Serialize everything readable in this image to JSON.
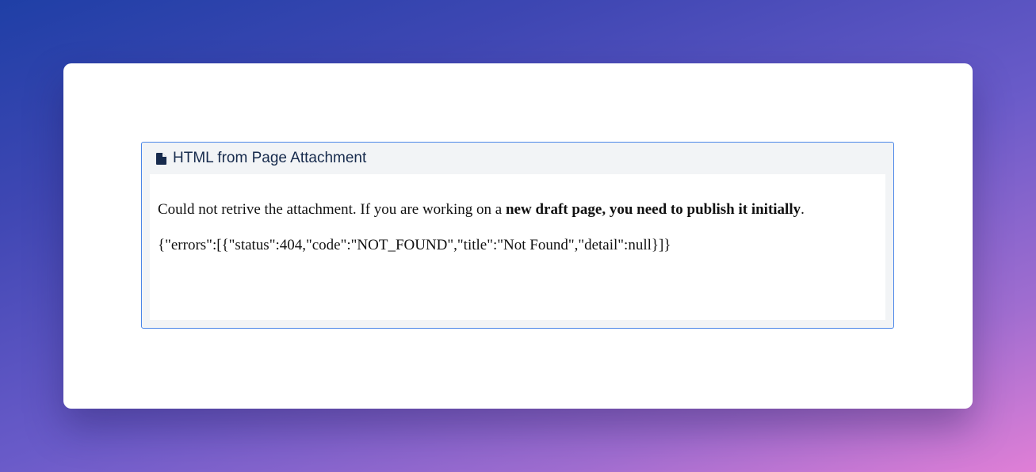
{
  "macro": {
    "title": "HTML from Page Attachment",
    "icon": "document-icon"
  },
  "content": {
    "message_prefix": "Could not retrive the attachment. If you are working on a ",
    "message_bold": "new draft page, you need to publish it initially",
    "message_suffix": ".",
    "error_json": "{\"errors\":[{\"status\":404,\"code\":\"NOT_FOUND\",\"title\":\"Not Found\",\"detail\":null}]}"
  },
  "colors": {
    "accent_border": "#4a86e8",
    "header_bg": "#f2f4f6",
    "header_text": "#172b4d"
  }
}
